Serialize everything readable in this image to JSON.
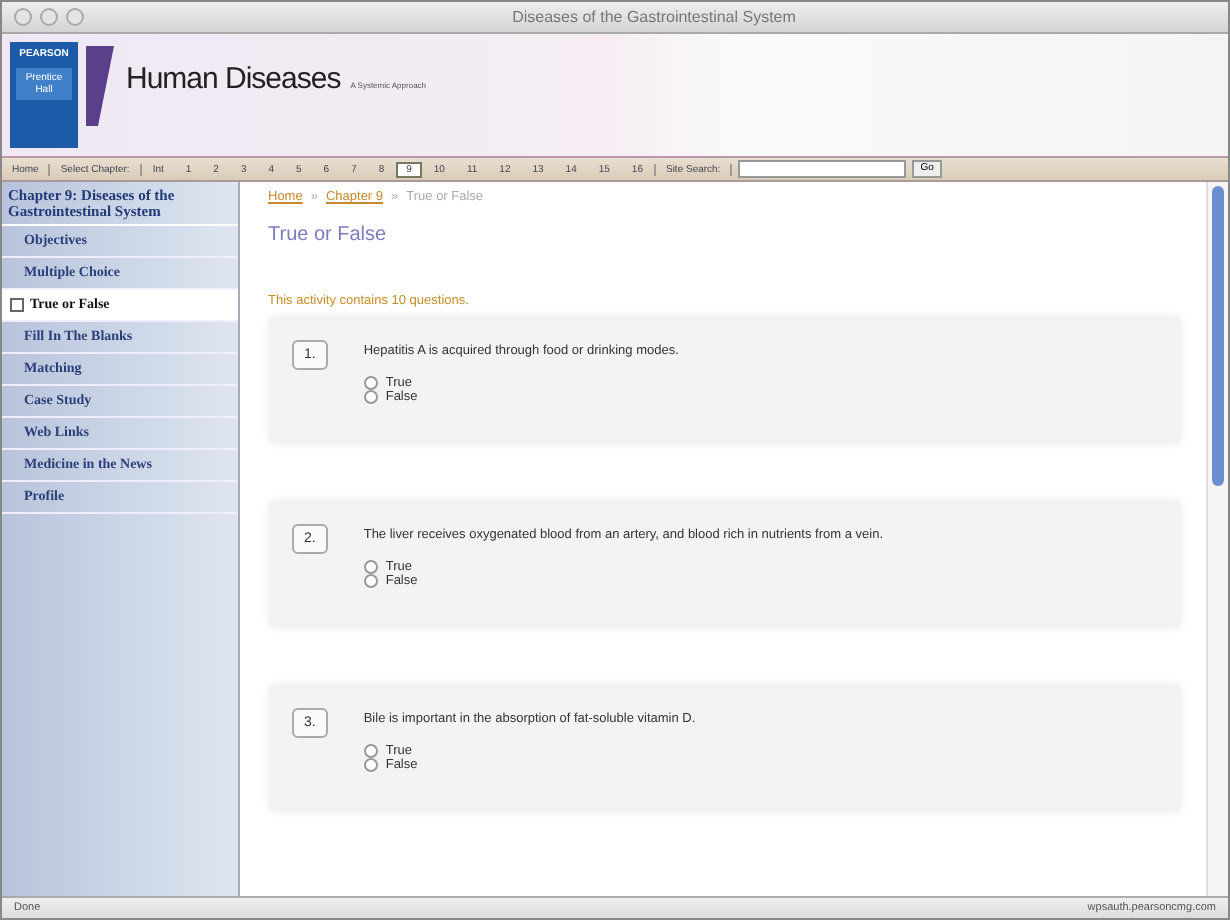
{
  "window": {
    "title": "Diseases of the Gastrointestinal System"
  },
  "banner": {
    "publisher": "PEARSON",
    "imprint": "Prentice Hall",
    "title": "Human Diseases",
    "subtitle": "A Systemic Approach"
  },
  "chapter_bar": {
    "home": "Home",
    "select_label": "Select Chapter:",
    "chapters": [
      {
        "label": "Int",
        "selected": false
      },
      {
        "label": "1",
        "selected": false
      },
      {
        "label": "2",
        "selected": false
      },
      {
        "label": "3",
        "selected": false
      },
      {
        "label": "4",
        "selected": false
      },
      {
        "label": "5",
        "selected": false
      },
      {
        "label": "6",
        "selected": false
      },
      {
        "label": "7",
        "selected": false
      },
      {
        "label": "8",
        "selected": false
      },
      {
        "label": "9",
        "selected": true
      },
      {
        "label": "10",
        "selected": false
      },
      {
        "label": "11",
        "selected": false
      },
      {
        "label": "12",
        "selected": false
      },
      {
        "label": "13",
        "selected": false
      },
      {
        "label": "14",
        "selected": false
      },
      {
        "label": "15",
        "selected": false
      },
      {
        "label": "16",
        "selected": false
      }
    ],
    "search_label": "Site Search:",
    "go": "Go"
  },
  "sidebar": {
    "heading": "Chapter 9: Diseases of the Gastrointestinal System",
    "items": [
      {
        "label": "Objectives",
        "selected": false
      },
      {
        "label": "Multiple Choice",
        "selected": false
      },
      {
        "label": "True or False",
        "selected": true
      },
      {
        "label": "Fill In The Blanks",
        "selected": false
      },
      {
        "label": "Matching",
        "selected": false
      },
      {
        "label": "Case Study",
        "selected": false
      },
      {
        "label": "Web Links",
        "selected": false
      },
      {
        "label": "Medicine in the News",
        "selected": false
      },
      {
        "label": "Profile",
        "selected": false
      }
    ]
  },
  "breadcrumb": [
    {
      "label": "Home",
      "link": true
    },
    {
      "label": "Chapter 9",
      "link": true
    },
    {
      "label": "True or False",
      "link": false
    }
  ],
  "separator": "»",
  "page_title": "True or False",
  "intro": "This activity contains 10 questions.",
  "questions": [
    {
      "number": "1.",
      "text": "Hepatitis A is acquired through food or drinking modes.",
      "options": [
        {
          "label": "True",
          "checked": false
        },
        {
          "label": "False",
          "checked": false
        }
      ]
    },
    {
      "number": "2.",
      "text": "The liver receives oxygenated blood from an artery, and blood rich in nutrients from a vein.",
      "options": [
        {
          "label": "True",
          "checked": false
        },
        {
          "label": "False",
          "checked": false
        }
      ]
    },
    {
      "number": "3.",
      "text": "Bile is important in the absorption of fat-soluble vitamin D.",
      "options": [
        {
          "label": "True",
          "checked": false
        },
        {
          "label": "False",
          "checked": false
        }
      ]
    }
  ],
  "status_bar": {
    "status": "Done",
    "host": "wpsauth.pearsoncmg.com"
  }
}
